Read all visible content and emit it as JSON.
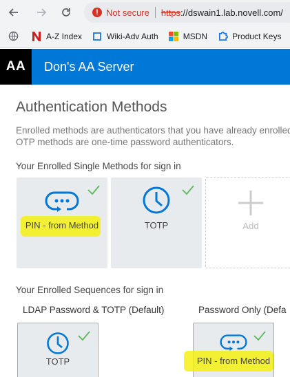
{
  "browser": {
    "security_label": "Not secure",
    "url_scheme": "https",
    "url_rest": "://dswain1.lab.novell.com/",
    "bookmarks": [
      {
        "label": "A-Z Index",
        "icon": "n-logo-icon"
      },
      {
        "label": "Wiki-Adv Auth",
        "icon": "page-icon"
      },
      {
        "label": "MSDN",
        "icon": "microsoft-logo-icon"
      },
      {
        "label": "Product Keys",
        "icon": "puzzle-icon"
      }
    ]
  },
  "header": {
    "logo": "AA",
    "title": "Don's AA Server"
  },
  "main": {
    "title": "Authentication Methods",
    "description_line1": "Enrolled methods are authenticators that you have already enrolled",
    "description_line2": "OTP methods are one-time password authenticators.",
    "single_methods_label": "Your Enrolled Single Methods for sign in",
    "single_methods": [
      {
        "label": "PIN - from Method",
        "icon": "pin-dots-icon",
        "enrolled": true
      },
      {
        "label": "TOTP",
        "icon": "clock-icon",
        "enrolled": true
      },
      {
        "label": "Add",
        "icon": "plus-icon",
        "enrolled": false
      }
    ],
    "sequences_label": "Your Enrolled Sequences for sign in",
    "sequences": [
      {
        "name": "LDAP Password & TOTP (Default)",
        "method": {
          "label": "TOTP",
          "icon": "clock-icon"
        }
      },
      {
        "name": "Password Only (Defa",
        "method": {
          "label": "PIN - from Method",
          "icon": "pin-dots-icon"
        }
      }
    ]
  },
  "colors": {
    "brand_blue": "#0078d7",
    "check_green": "#5cb85c",
    "highlight_yellow": "#f5f00a",
    "insecure_red": "#d93025"
  }
}
